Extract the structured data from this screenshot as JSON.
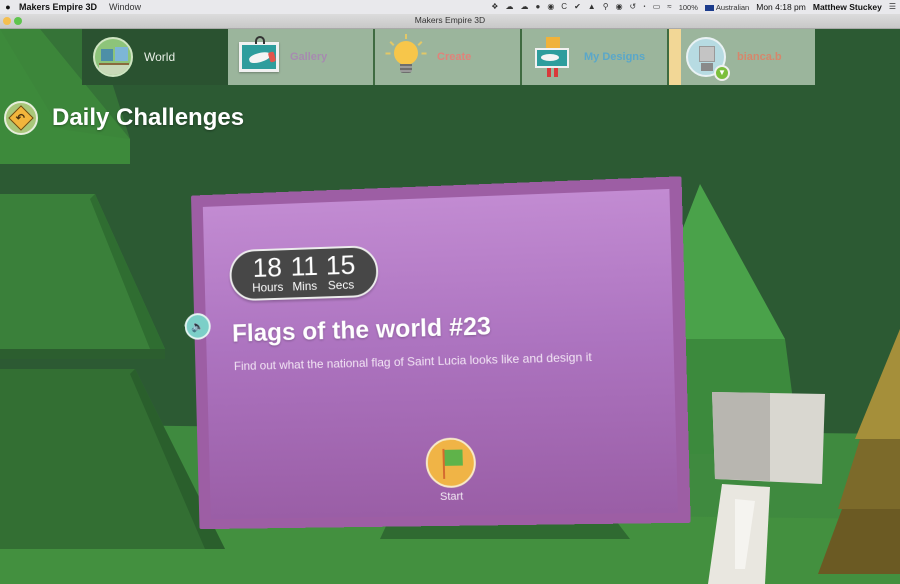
{
  "menubar": {
    "apple_icon": "apple-logo-icon",
    "app_name": "Makers Empire 3D",
    "menu_items": [
      "Window"
    ],
    "status_icons": [
      "dropbox-icon",
      "cloud-sync-icon",
      "cloud-error-icon",
      "wechat-icon",
      "app-icon",
      "c-icon",
      "check-icon",
      "drive-icon",
      "search-icon",
      "siri-icon",
      "time-machine-icon",
      "bluetooth-icon",
      "airplay-icon",
      "wifi-icon"
    ],
    "battery": "100%",
    "keyboard_layout": "Australian",
    "clock": "Mon 4:18 pm",
    "user": "Matthew Stuckey"
  },
  "window": {
    "title": "Makers Empire 3D"
  },
  "nav": {
    "tabs": [
      {
        "label": "World",
        "icon": "world-icon",
        "color": "#e8efe6",
        "active": true
      },
      {
        "label": "Gallery",
        "icon": "gallery-frame-icon",
        "color": "#a78bb0",
        "active": false
      },
      {
        "label": "Create",
        "icon": "lightbulb-icon",
        "color": "#e0837a",
        "active": false
      },
      {
        "label": "My Designs",
        "icon": "my-designs-icon",
        "color": "#5aa7c9",
        "active": false
      },
      {
        "label": "bianca.b",
        "icon": "avatar-icon",
        "color": "#d6876c",
        "active": false
      }
    ]
  },
  "header": {
    "title": "Daily Challenges",
    "back_icon": "back-arrow-sign-icon"
  },
  "challenge": {
    "timer": {
      "hours": "18",
      "hours_label": "Hours",
      "mins": "11",
      "mins_label": "Mins",
      "secs": "15",
      "secs_label": "Secs"
    },
    "title": "Flags of the world #23",
    "description": "Find out what the national flag of Saint Lucia looks like and design it",
    "start_label": "Start",
    "speaker_icon": "speaker-icon",
    "card_color": "#b77fc8"
  },
  "colors": {
    "scene_bg": "#2c5a33",
    "tab_inactive": "#9bb59c",
    "tab_active": "#2a5230"
  }
}
